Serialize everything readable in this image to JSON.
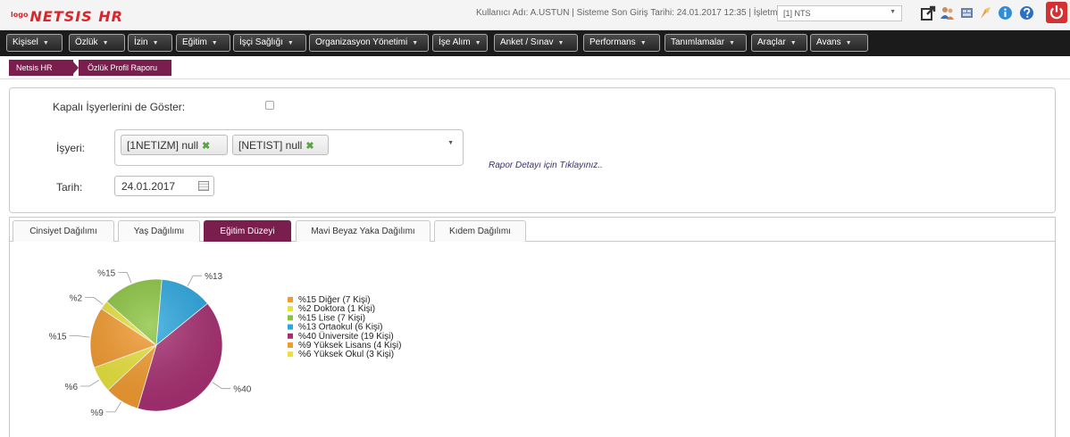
{
  "header": {
    "logo_prefix": "logo",
    "logo_text": "NETSIS HR",
    "user_info": "Kullanıcı Adı: A.USTUN | Sisteme Son Giriş Tarihi: 24.01.2017 12:35 | İşletme:",
    "company_value": "[1] NTS"
  },
  "nav": {
    "items": [
      "Kişisel",
      "Özlük",
      "İzin",
      "Eğitim",
      "İşçi Sağlığı",
      "Organizasyon Yönetimi",
      "İşe Alım",
      "Anket / Sınav",
      "Performans",
      "Tanımlamalar",
      "Araçlar",
      "Avans"
    ]
  },
  "breadcrumb": {
    "home": "Netsis HR",
    "page": "Özlük Profil Raporu"
  },
  "filters": {
    "closed_label": "Kapalı İşyerlerini de Göster:",
    "workplace_label": "İşyeri:",
    "workplace_tags": [
      "[1NETIZM] null",
      "[NETIST] null"
    ],
    "report_link": "Rapor Detayı için Tıklayınız..",
    "date_label": "Tarih:",
    "date_value": "24.01.2017"
  },
  "tabs": [
    {
      "label": "Cinsiyet Dağılımı",
      "active": false
    },
    {
      "label": "Yaş Dağılımı",
      "active": false
    },
    {
      "label": "Eğitim Düzeyi",
      "active": true
    },
    {
      "label": "Mavi Beyaz Yaka Dağılımı",
      "active": false
    },
    {
      "label": "Kıdem Dağılımı",
      "active": false
    }
  ],
  "chart_data": {
    "type": "pie",
    "title": "",
    "legend_position": "right",
    "slices": [
      {
        "percent_label": "%15",
        "legend": "%15 Diğer (7 Kişi)",
        "count": 7,
        "color": "#f29a2e"
      },
      {
        "percent_label": "%2",
        "legend": "%2 Doktora (1 Kişi)",
        "count": 1,
        "color": "#e7e23a"
      },
      {
        "percent_label": "%15",
        "legend": "%15 Lise (7 Kişi)",
        "count": 7,
        "color": "#8ac43f"
      },
      {
        "percent_label": "%13",
        "legend": "%13 Ortaokul (6 Kişi)",
        "count": 6,
        "color": "#2aa6de"
      },
      {
        "percent_label": "%40",
        "legend": "%40 Üniversite (19 Kişi)",
        "count": 19,
        "color": "#a72e71"
      },
      {
        "percent_label": "%9",
        "legend": "%9 Yüksek Lisans (4 Kişi)",
        "count": 4,
        "color": "#f29a2e"
      },
      {
        "percent_label": "%6",
        "legend": "%6 Yüksek Okul (3 Kişi)",
        "count": 3,
        "color": "#e7e23a"
      }
    ]
  }
}
